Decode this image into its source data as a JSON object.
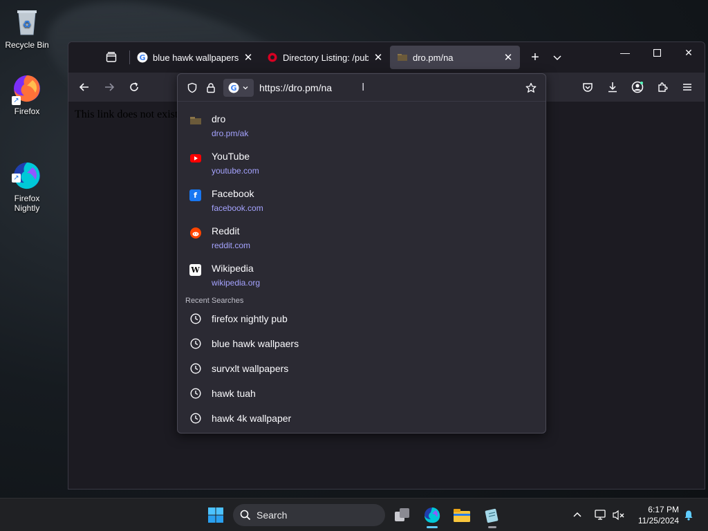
{
  "desktop": {
    "icons": [
      {
        "label": "Recycle Bin"
      },
      {
        "label": "Firefox"
      },
      {
        "label": "Firefox\nNightly"
      }
    ]
  },
  "browser": {
    "tabs": [
      {
        "title": "blue hawk wallpapers - Google Search",
        "favicon": "google-icon",
        "active": false
      },
      {
        "title": "Directory Listing: /pub/firefox/nightly/",
        "favicon": "mozilla-icon",
        "active": false
      },
      {
        "title": "dro.pm/na",
        "favicon": "folder-favicon",
        "active": true
      }
    ],
    "page_text": "This link does not exist",
    "urlbar": {
      "value": "https://dro.pm/na",
      "results": [
        {
          "title": "dro",
          "url": "dro.pm/ak",
          "icon": "folder-favicon"
        },
        {
          "title": "YouTube",
          "url": "youtube.com",
          "icon": "youtube-icon"
        },
        {
          "title": "Facebook",
          "url": "facebook.com",
          "icon": "facebook-icon"
        },
        {
          "title": "Reddit",
          "url": "reddit.com",
          "icon": "reddit-icon"
        },
        {
          "title": "Wikipedia",
          "url": "wikipedia.org",
          "icon": "wikipedia-icon"
        }
      ],
      "recent_label": "Recent Searches",
      "recent_searches": [
        "firefox nightly pub",
        "blue hawk wallpaers",
        "survxlt wallpapers",
        "hawk tuah",
        "hawk 4k wallpaper"
      ]
    }
  },
  "taskbar": {
    "search_label": "Search",
    "time": "6:17 PM",
    "date": "11/25/2024"
  },
  "colors": {
    "accent_url": "#a5a3ff",
    "youtube": "#ff0000",
    "facebook": "#1877f2",
    "reddit": "#ff4500",
    "taskbar_active": "#60cdff"
  }
}
